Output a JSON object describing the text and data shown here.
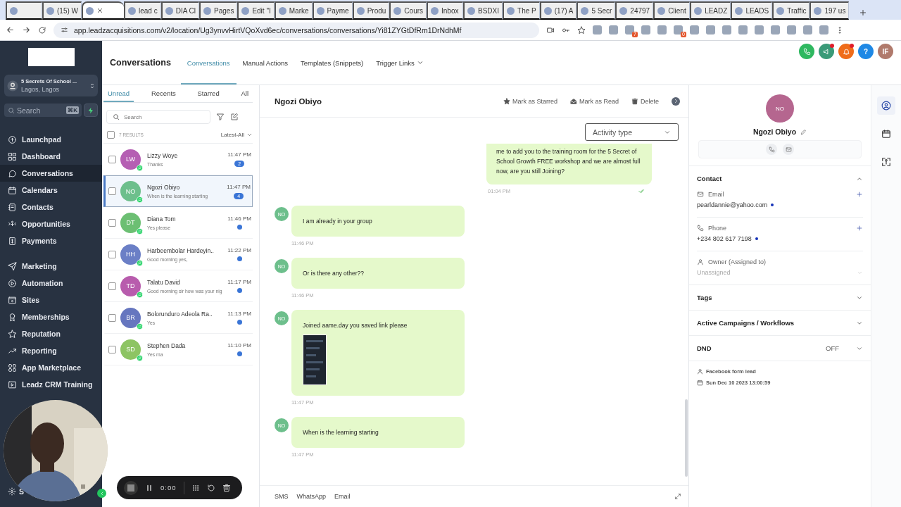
{
  "browser": {
    "tabs": [
      {
        "selected": false
      },
      {
        "title": "(15) W",
        "selected": false
      },
      {
        "selected": true
      },
      {
        "title": "lead c",
        "selected": false
      },
      {
        "title": "DIA Cl",
        "selected": false
      },
      {
        "title": "Pages",
        "selected": false
      },
      {
        "title": "Edit \"I",
        "selected": false
      },
      {
        "title": "Marke",
        "selected": false
      },
      {
        "title": "Payme",
        "selected": false
      },
      {
        "title": "Produ",
        "selected": false
      },
      {
        "title": "Cours",
        "selected": false
      },
      {
        "title": "Inbox",
        "selected": false
      },
      {
        "title": "BSDXI",
        "selected": false
      },
      {
        "title": "The P",
        "selected": false
      },
      {
        "title": "(17) A",
        "selected": false
      },
      {
        "title": "5 Secr",
        "selected": false
      },
      {
        "title": "24797",
        "selected": false
      },
      {
        "title": "Client",
        "selected": false
      },
      {
        "title": "LEADZ",
        "selected": false
      },
      {
        "title": "LEADS",
        "selected": false
      },
      {
        "title": "Traffic",
        "selected": false
      },
      {
        "title": "197 us",
        "selected": false
      }
    ],
    "url": "app.leadzacquisitions.com/v2/location/Ug3ynvvHirtVQoXvd6ec/conversations/conversations/Yi81ZYGtDfRm1DrNdhMf",
    "extensions": [
      {
        "kind": "plain"
      },
      {
        "kind": "plain"
      },
      {
        "kind": "badge",
        "badge": "7"
      },
      {
        "kind": "plain"
      },
      {
        "kind": "plain"
      },
      {
        "kind": "badge",
        "badge": "0"
      },
      {
        "kind": "plain"
      },
      {
        "kind": "plain"
      },
      {
        "kind": "plain"
      },
      {
        "kind": "plain"
      },
      {
        "kind": "plain"
      },
      {
        "kind": "plain"
      },
      {
        "kind": "plain"
      },
      {
        "kind": "plain"
      },
      {
        "kind": "plain"
      }
    ]
  },
  "sidebar": {
    "account": {
      "name": "5 Secrets Of School ...",
      "location": "Lagos, Lagos"
    },
    "search": {
      "placeholder": "Search",
      "shortcut": "⌘K"
    },
    "nav": [
      {
        "items": [
          {
            "label": "Launchpad",
            "selected": false
          },
          {
            "label": "Dashboard",
            "selected": false
          },
          {
            "label": "Conversations",
            "selected": true
          },
          {
            "label": "Calendars",
            "selected": false
          },
          {
            "label": "Contacts",
            "selected": false
          },
          {
            "label": "Opportunities",
            "selected": false
          },
          {
            "label": "Payments",
            "selected": false
          }
        ]
      },
      {
        "items": [
          {
            "label": "Marketing",
            "selected": false
          },
          {
            "label": "Automation",
            "selected": false
          },
          {
            "label": "Sites",
            "selected": false
          },
          {
            "label": "Memberships",
            "selected": false
          },
          {
            "label": "Reputation",
            "selected": false
          },
          {
            "label": "Reporting",
            "selected": false
          },
          {
            "label": "App Marketplace",
            "selected": false
          },
          {
            "label": "Leadz CRM Training",
            "selected": false
          }
        ]
      }
    ],
    "settings_label": "S"
  },
  "header": {
    "title": "Conversations",
    "tabs": [
      {
        "label": "Conversations",
        "selected": true,
        "has_menu": false
      },
      {
        "label": "Manual Actions",
        "selected": false,
        "has_menu": false
      },
      {
        "label": "Templates (Snippets)",
        "selected": false,
        "has_menu": false
      },
      {
        "label": "Trigger Links",
        "selected": false,
        "has_menu": true
      }
    ],
    "actions": [
      {
        "kind": "phone",
        "color": "#2fb860"
      },
      {
        "kind": "megaphone",
        "color": "#3a9a78",
        "alert": true
      },
      {
        "kind": "bell",
        "color": "#ef6c1a",
        "alert": true
      },
      {
        "kind": "help",
        "color": "#1e88e5",
        "text": "?"
      },
      {
        "kind": "avatar",
        "color": "#b07a6c",
        "text": "IF"
      }
    ]
  },
  "list": {
    "filters": [
      {
        "label": "Unread",
        "selected": true
      },
      {
        "label": "Recents",
        "selected": false
      },
      {
        "label": "Starred",
        "selected": false
      },
      {
        "label": "All",
        "selected": false
      }
    ],
    "search": {
      "placeholder": "Search"
    },
    "select_all_checked": false,
    "results": "7 RESULTS",
    "sort": "Latest-All",
    "items": [
      {
        "initials": "LW",
        "color": "#b55fb3",
        "name": "Lizzy Woye",
        "preview": "Thanks",
        "time": "11:47 PM",
        "unread": true,
        "unread_count": "2",
        "checked": false,
        "selected": false
      },
      {
        "initials": "NO",
        "color": "#6dbf8c",
        "name": "Ngozi Obiyo",
        "preview": "When is the learning starting",
        "time": "11:47 PM",
        "unread": true,
        "unread_count": "4",
        "checked": false,
        "selected": true
      },
      {
        "initials": "DT",
        "color": "#6cbf73",
        "name": "Diana Tom",
        "preview": "Yes please",
        "time": "11:46 PM",
        "unread": true,
        "checked": false,
        "selected": false
      },
      {
        "initials": "HH",
        "color": "#6b7fc6",
        "name": "Harbeembolar Hardeyin..",
        "preview": "Good morning yes,",
        "time": "11:22 PM",
        "unread": true,
        "checked": false,
        "selected": false
      },
      {
        "initials": "TD",
        "color": "#b85cad",
        "name": "Talatu David",
        "preview": "Good morning sir how was your nig",
        "time": "11:17 PM",
        "unread": true,
        "checked": false,
        "selected": false
      },
      {
        "initials": "BR",
        "color": "#6676bf",
        "name": "Bolorunduro Adeola Ra..",
        "preview": "Yes",
        "time": "11:13 PM",
        "unread": true,
        "checked": false,
        "selected": false
      },
      {
        "initials": "SD",
        "color": "#8dc463",
        "name": "Stephen Dada",
        "preview": "Yes ma",
        "time": "11:10 PM",
        "unread": true,
        "checked": false,
        "selected": false
      }
    ]
  },
  "chat": {
    "contact_name": "Ngozi Obiyo",
    "actions": [
      {
        "kind": "star",
        "label": "Mark as Starred"
      },
      {
        "kind": "read",
        "label": "Mark as Read"
      },
      {
        "kind": "delete",
        "label": "Delete"
      }
    ],
    "activity_filter": "Activity type",
    "messages": [
      {
        "kind": "outbound",
        "text": "me to add you to the training room for the 5 Secret of School Growth FREE workshop and we are almost full now, are you still Joining?",
        "time": "01:04 PM",
        "read": true
      },
      {
        "kind": "inbound",
        "avatar": "NO",
        "text": "I am already in your group",
        "time": "11:46 PM"
      },
      {
        "kind": "inbound",
        "avatar": "NO",
        "text": "Or is there any other??",
        "time": "11:46 PM"
      },
      {
        "kind": "inbound",
        "avatar": "NO",
        "text": "Joined aame.day you saved link please",
        "time": "11:47 PM"
      },
      {
        "kind": "inbound",
        "avatar": "NO",
        "text": "When is the learning starting",
        "time": "11:47 PM"
      }
    ],
    "composer_tabs": [
      "SMS",
      "WhatsApp",
      "Email"
    ]
  },
  "contact": {
    "initials": "NO",
    "color": "#b5668f",
    "name": "Ngozi Obiyo",
    "contact_section": {
      "title": "Contact",
      "expanded": true,
      "fields": [
        {
          "kind": "email",
          "label": "Email",
          "value": "pearldannie@yahoo.com",
          "verified": true
        },
        {
          "kind": "phone",
          "label": "Phone",
          "value": "+234 802 617 7198",
          "verified": true
        }
      ],
      "owner": {
        "label": "Owner (Assigned to)",
        "placeholder": "Unassigned"
      }
    },
    "sections": [
      {
        "title": "Tags",
        "expanded": false
      },
      {
        "title": "Active Campaigns / Workflows",
        "expanded": false
      },
      {
        "title": "DND",
        "value": "OFF",
        "expanded": false
      }
    ],
    "source": "Facebook form lead",
    "created": "Sun Dec 10 2023 13:00:59"
  },
  "rail": [
    {
      "kind": "person",
      "selected": true
    },
    {
      "kind": "calendar",
      "selected": false
    },
    {
      "kind": "expand",
      "selected": false
    }
  ],
  "recorder": {
    "time": "0:00"
  }
}
